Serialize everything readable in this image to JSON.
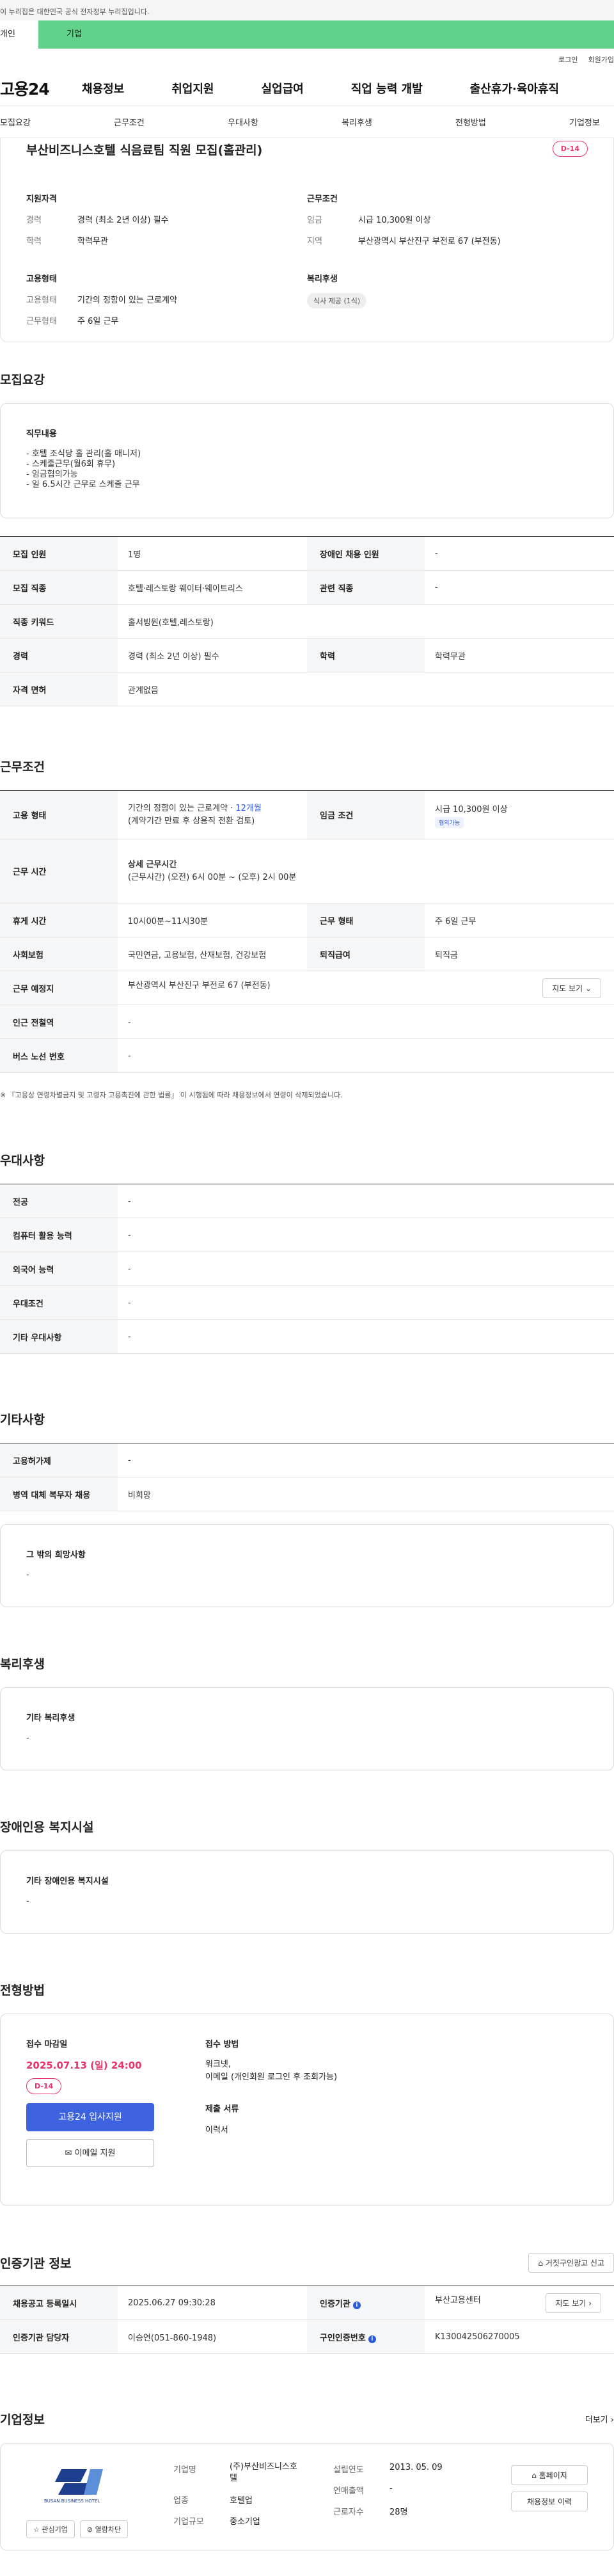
{
  "gov_banner": "이 누리집은 대한민국 공식 전자정부 누리집입니다.",
  "user_tabs": [
    "개인",
    "기업"
  ],
  "util": [
    "로그인",
    "회원가입"
  ],
  "logo": "고용24",
  "gnb": [
    "채용정보",
    "취업지원",
    "실업급여",
    "직업 능력 개발",
    "출산휴가·육아휴직"
  ],
  "subnav": [
    "모집요강",
    "근무조건",
    "우대사항",
    "복리후생",
    "전형방법",
    "기업정보"
  ],
  "title": "부산비즈니스호텔 식음료팀 직원 모집(홀관리)",
  "dday": "D-14",
  "summary": {
    "qual_head": "지원자격",
    "career_k": "경력",
    "career_v": "경력 (최소 2년 이상) 필수",
    "edu_k": "학력",
    "edu_v": "학력무관",
    "emp_head": "고용형태",
    "emptype_k": "고용형태",
    "emptype_v": "기간의 정함이 있는 근로계약",
    "worktype_k": "근무형태",
    "worktype_v": "주 6일 근무",
    "cond_head": "근무조건",
    "wage_k": "임금",
    "wage_v": "시급 10,300원 이상",
    "area_k": "지역",
    "area_v": "부산광역시 부산진구 부전로 67 (부전동)",
    "welfare_head": "복리후생",
    "welfare_badge": "식사 제공 (1식)"
  },
  "recruit": {
    "heading": "모집요강",
    "duty_title": "직무내용",
    "duty_lines": [
      "- 호텔 조식당 홀 관리(홀 매니저)",
      "- 스케줄근무(월6회 휴무)",
      "- 임금협의가능",
      "- 일 6.5시간 근무로 스케줄 근무"
    ],
    "rows": [
      [
        "모집 인원",
        "1명",
        "장애인 채용 인원",
        "-"
      ],
      [
        "모집 직종",
        "호텔·레스토랑 웨이터·웨이트리스",
        "관련 직종",
        "-"
      ],
      [
        "직종 키워드",
        "홀서빙원(호텔,레스토랑)",
        "",
        ""
      ],
      [
        "경력",
        "경력 (최소 2년 이상) 필수",
        "학력",
        "학력무관"
      ],
      [
        "자격 면허",
        "관계없음",
        "",
        ""
      ]
    ]
  },
  "work": {
    "heading": "근무조건",
    "emp_k": "고용 형태",
    "emp_v1": "기간의 정함이 있는 근로계약 · ",
    "emp_months": "12개월",
    "emp_v2": "(계약기간 만료 후 상용직 전환 검토)",
    "wage_k": "임금 조건",
    "wage_v": "시급 10,300원 이상",
    "wage_badge": "협의가능",
    "time_k": "근무 시간",
    "time_title": "상세 근무시간",
    "time_v": "(근무시간) (오전) 6시 00분 ~ (오후) 2시 00분",
    "rest_k": "휴게 시간",
    "rest_v": "10시00분~11시30분",
    "wtype_k": "근무 형태",
    "wtype_v": "주 6일 근무",
    "ins_k": "사회보험",
    "ins_v": "국민연금, 고용보험, 산재보험, 건강보험",
    "ret_k": "퇴직급여",
    "ret_v": "퇴직금",
    "place_k": "근무 예정지",
    "place_v": "부산광역시 부산진구 부전로 67 (부전동)",
    "map_btn": "지도 보기",
    "sub_k": "인근 전철역",
    "sub_v": "-",
    "bus_k": "버스 노선 번호",
    "bus_v": "-",
    "note": "※ 『고용상 연령차별금지 및 고령자 고용촉진에 관한 법률』 이 시행됨에 따라 채용정보에서 연령이 삭제되었습니다."
  },
  "pref": {
    "heading": "우대사항",
    "rows": [
      [
        "전공",
        "-"
      ],
      [
        "컴퓨터 활용 능력",
        "-"
      ],
      [
        "외국어 능력",
        "-"
      ],
      [
        "우대조건",
        "-"
      ],
      [
        "기타 우대사항",
        "-"
      ]
    ]
  },
  "etc": {
    "heading": "기타사항",
    "rows": [
      [
        "고용허가제",
        "-"
      ],
      [
        "병역 대체 복무자 채용",
        "비희망"
      ]
    ],
    "box_title": "그 밖의 희망사항",
    "box_value": "-"
  },
  "welfare": {
    "heading": "복리후생",
    "box_title": "기타 복리후생",
    "box_value": "-"
  },
  "disabled": {
    "heading": "장애인용 복지시설",
    "box_title": "기타 장애인용 복지시설",
    "box_value": "-"
  },
  "apply": {
    "heading": "전형방법",
    "deadline_label": "접수 마감일",
    "deadline": "2025.07.13 (일) 24:00",
    "dday": "D-14",
    "btn_apply": "고용24 입사지원",
    "btn_email": "이메일 지원",
    "method_label": "접수 방법",
    "method_v1": "워크넷,",
    "method_v2": "이메일 (개인회원 로그인 후 조회가능)",
    "docs_label": "제출 서류",
    "docs_v": "이력서"
  },
  "cert": {
    "heading": "인증기관 정보",
    "report_btn": "거짓구인광고 신고",
    "reg_k": "채용공고 등록일시",
    "reg_v": "2025.06.27 09:30:28",
    "org_k": "인증기관",
    "org_v": "부산고용센터",
    "map_btn": "지도 보기",
    "mgr_k": "인증기관 담당자",
    "mgr_v": "이승연(051-860-1948)",
    "num_k": "구인인증번호",
    "num_v": "K130042506270005"
  },
  "company": {
    "heading": "기업정보",
    "more": "더보기",
    "name_k": "기업명",
    "name_v": "(주)부산비즈니스호텔",
    "industry_k": "업종",
    "industry_v": "호텔업",
    "scale_k": "기업규모",
    "scale_v": "중소기업",
    "founded_k": "설립연도",
    "founded_v": "2013. 05. 09",
    "sales_k": "연매출액",
    "sales_v": "-",
    "emp_k": "근로자수",
    "emp_v": "28명",
    "btn_home": "홈페이지",
    "btn_history": "채용정보 이력",
    "btn_fav": "관심기업",
    "btn_block": "열람차단",
    "logo_text": "BUSAN BUSINESS HOTEL",
    "brand_color": "#1e3f8f"
  },
  "colors": {
    "accent": "#3d63e0",
    "dday": "#e8336b",
    "tab_green": "#62d28a"
  }
}
